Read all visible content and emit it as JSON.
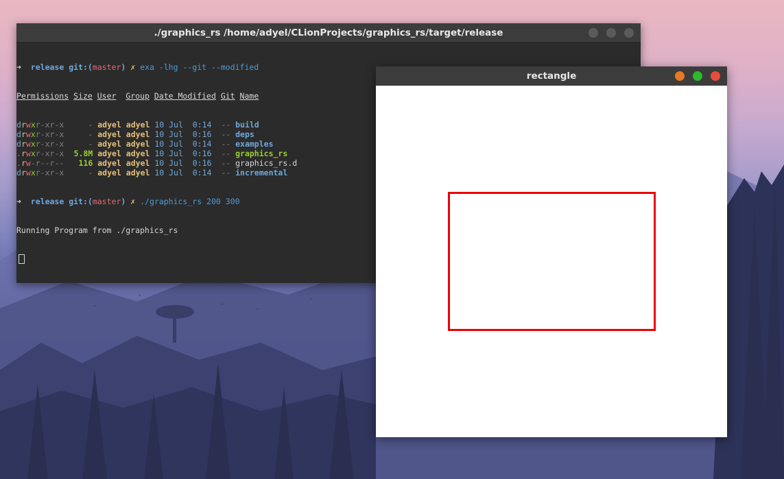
{
  "terminal": {
    "title": "./graphics_rs /home/adyel/CLionProjects/graphics_rs/target/release",
    "prompt1": {
      "arrow": "➜",
      "dir": "release",
      "git_prefix": "git:(",
      "branch": "master",
      "git_suffix": ")",
      "dirty": "✗",
      "command": "exa -lhg --git --modified"
    },
    "headers": [
      "Permissions",
      "Size",
      "User",
      "Group",
      "Date Modified",
      "Git",
      "Name"
    ],
    "rows": [
      {
        "perm_type": "d",
        "perm_r": "r",
        "perm_w": "w",
        "perm_x": "x",
        "perm_rest": "r-xr-x",
        "size": "-",
        "user": "adyel",
        "group": "adyel",
        "date": "10 Jul  0:14",
        "git": "--",
        "name": "build",
        "kind": "dir"
      },
      {
        "perm_type": "d",
        "perm_r": "r",
        "perm_w": "w",
        "perm_x": "x",
        "perm_rest": "r-xr-x",
        "size": "-",
        "user": "adyel",
        "group": "adyel",
        "date": "10 Jul  0:16",
        "git": "--",
        "name": "deps",
        "kind": "dir"
      },
      {
        "perm_type": "d",
        "perm_r": "r",
        "perm_w": "w",
        "perm_x": "x",
        "perm_rest": "r-xr-x",
        "size": "-",
        "user": "adyel",
        "group": "adyel",
        "date": "10 Jul  0:14",
        "git": "--",
        "name": "examples",
        "kind": "dir"
      },
      {
        "perm_type": ".",
        "perm_r": "r",
        "perm_w": "w",
        "perm_x": "x",
        "perm_rest": "r-xr-x",
        "size": "5.8M",
        "user": "adyel",
        "group": "adyel",
        "date": "10 Jul  0:16",
        "git": "--",
        "name": "graphics_rs",
        "kind": "exe"
      },
      {
        "perm_type": ".",
        "perm_r": "r",
        "perm_w": "w",
        "perm_x": "-",
        "perm_rest": "r--r--",
        "size": "116",
        "user": "adyel",
        "group": "adyel",
        "date": "10 Jul  0:16",
        "git": "--",
        "name": "graphics_rs.d",
        "kind": "file"
      },
      {
        "perm_type": "d",
        "perm_r": "r",
        "perm_w": "w",
        "perm_x": "x",
        "perm_rest": "r-xr-x",
        "size": "-",
        "user": "adyel",
        "group": "adyel",
        "date": "10 Jul  0:14",
        "git": "--",
        "name": "incremental",
        "kind": "dir"
      }
    ],
    "prompt2": {
      "arrow": "➜",
      "dir": "release",
      "git_prefix": "git:(",
      "branch": "master",
      "git_suffix": ")",
      "dirty": "✗",
      "command": "./graphics_rs 200 300"
    },
    "output": "Running Program from ./graphics_rs"
  },
  "rect_window": {
    "title": "rectangle",
    "buttons": {
      "minimize_color": "#e87722",
      "maximize_color": "#2eb82e",
      "close_color": "#e74c3c"
    },
    "rectangle": {
      "width": 300,
      "height": 200,
      "color": "#ee0000"
    }
  },
  "colors": {
    "terminal_bg": "#2b2b2b",
    "titlebar_bg": "#3c3c3c"
  }
}
